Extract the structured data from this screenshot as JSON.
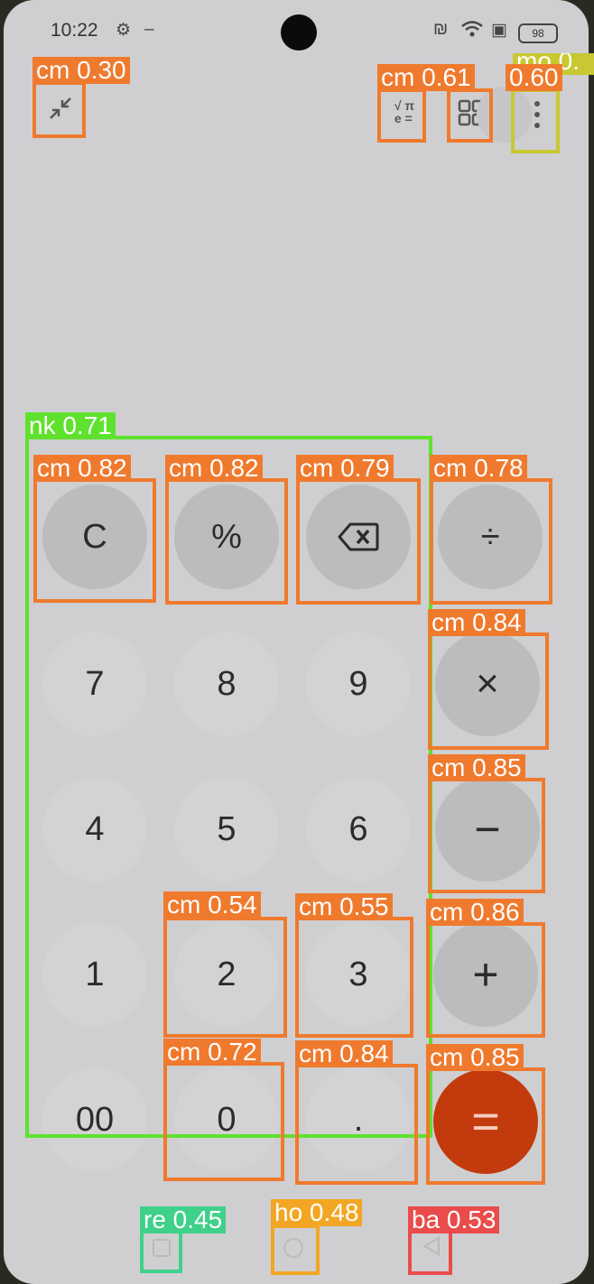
{
  "status_bar": {
    "time": "10:22",
    "battery": "98"
  },
  "toolbar": {
    "collapse_icon": "collapse-icon",
    "scientific_top": "√ π",
    "scientific_bottom": "e =",
    "grid_icon": "grid-icon",
    "more_icon": "more-vert-icon"
  },
  "keypad": {
    "clear": "C",
    "percent": "%",
    "backspace_icon": "backspace-icon",
    "divide": "÷",
    "multiply": "×",
    "minus": "−",
    "plus": "+",
    "equals": "=",
    "seven": "7",
    "eight": "8",
    "nine": "9",
    "four": "4",
    "five": "5",
    "six": "6",
    "one": "1",
    "two": "2",
    "three": "3",
    "double_zero": "00",
    "zero": "0",
    "decimal": "."
  },
  "detections": [
    {
      "label": "cm 0.30"
    },
    {
      "label": "cm 0.61"
    },
    {
      "label": "0.60"
    },
    {
      "label": "mo 0."
    },
    {
      "label": "nk 0.71"
    },
    {
      "label": "cm 0.82"
    },
    {
      "label": "cm 0.82"
    },
    {
      "label": "cm 0.79"
    },
    {
      "label": "cm 0.78"
    },
    {
      "label": "cm 0.84"
    },
    {
      "label": "cm 0.85"
    },
    {
      "label": "cm 0.54"
    },
    {
      "label": "cm 0.55"
    },
    {
      "label": "cm 0.86"
    },
    {
      "label": "cm 0.72"
    },
    {
      "label": "cm 0.84"
    },
    {
      "label": "cm 0.85"
    },
    {
      "label": "re 0.45"
    },
    {
      "label": "ho 0.48"
    },
    {
      "label": "ba 0.53"
    }
  ],
  "colors": {
    "box_orange": "#ef7a2e",
    "box_green": "#5ee22d",
    "box_yellow": "#c8c832",
    "box_teal": "#3fd08a",
    "box_gold": "#f2a623",
    "box_red": "#ea4b4b",
    "equals_bg": "#c33b0c"
  }
}
